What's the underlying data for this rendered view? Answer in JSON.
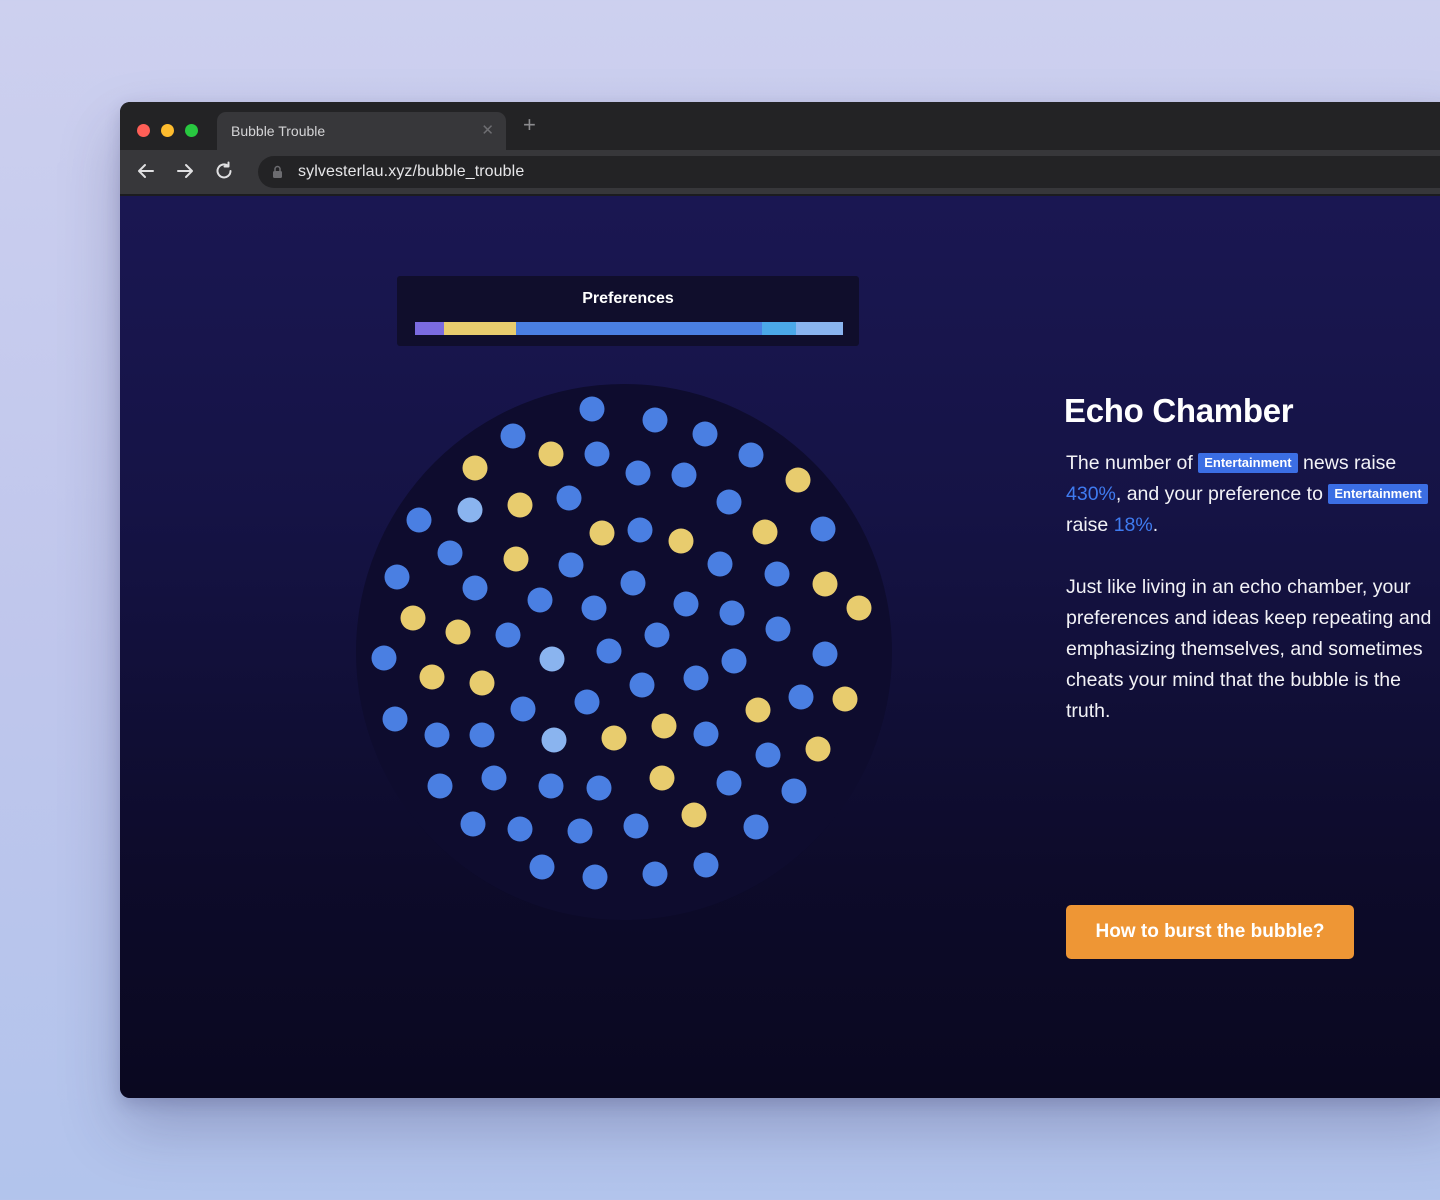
{
  "browser": {
    "tab_title": "Bubble Trouble",
    "url": "sylvesterlau.xyz/bubble_trouble",
    "icons": [
      "back-arrow-icon",
      "forward-arrow-icon",
      "reload-icon",
      "lock-icon",
      "close-icon",
      "plus-icon"
    ]
  },
  "preferences": {
    "title": "Preferences",
    "segments": [
      {
        "color": "#7b6be0",
        "share": 0.068
      },
      {
        "color": "#e8cc6e",
        "share": 0.168
      },
      {
        "color": "#4a7fe2",
        "share": 0.575
      },
      {
        "color": "#4ba8e8",
        "share": 0.08
      },
      {
        "color": "#8ab4ef",
        "share": 0.109
      }
    ]
  },
  "colors": {
    "blue": "#4a7fe2",
    "yellow": "#e8cc6e",
    "light_blue": "#8ab4ef",
    "cta": "#ee9635",
    "highlight": "#3f7bf0",
    "tag": "#3b6ee4"
  },
  "bubble_counts": {
    "blue": 64,
    "yellow": 26,
    "light_blue": 3
  },
  "content": {
    "heading": "Echo Chamber",
    "p1_part1": "The number of ",
    "tag1": "Entertainment",
    "p1_part2": " news raise ",
    "pct1": "430%",
    "p1_part3": ", and your preference to ",
    "tag2": "Entertainment",
    "p1_part4": " raise ",
    "pct2": "18%",
    "p1_part5": ".",
    "p2": "Just like living in an echo chamber, your preferences and ideas keep repeating and emphasizing themselves, and sometimes cheats your mind that the bubble is the truth.",
    "cta": "How to burst the bubble?"
  }
}
